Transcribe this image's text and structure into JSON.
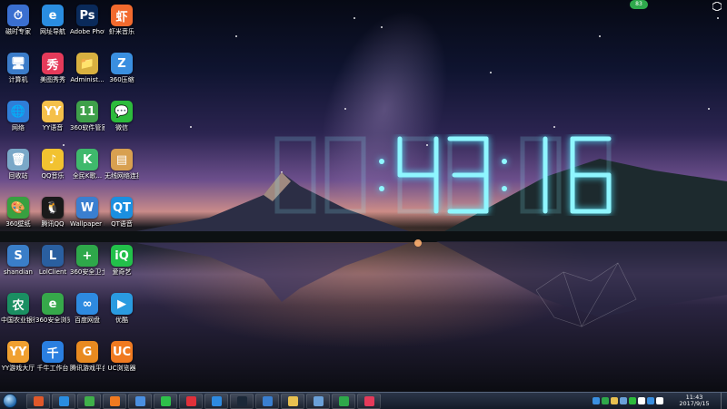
{
  "wallpaper_clock": {
    "digits": "11:43:16"
  },
  "badge": {
    "text": "83"
  },
  "desktop_icons": [
    {
      "name": "icon-0",
      "label": "磁时专家",
      "color": "#3a6fd0",
      "glyph": "⏱"
    },
    {
      "name": "icon-1",
      "label": "网址导航",
      "color": "#2a8de0",
      "glyph": "e"
    },
    {
      "name": "icon-2",
      "label": "Adobe Photosh...",
      "color": "#0a2a5a",
      "glyph": "Ps"
    },
    {
      "name": "icon-3",
      "label": "虾米音乐",
      "color": "#f26a2e",
      "glyph": "虾"
    },
    {
      "name": "icon-4",
      "label": "计算机",
      "color": "#3b7cc9",
      "glyph": "🖥"
    },
    {
      "name": "icon-5",
      "label": "美图秀秀",
      "color": "#e53a5a",
      "glyph": "秀"
    },
    {
      "name": "icon-6",
      "label": "Administ...",
      "color": "#d8b040",
      "glyph": "📁"
    },
    {
      "name": "icon-7",
      "label": "360压缩",
      "color": "#3a8fe0",
      "glyph": "Z"
    },
    {
      "name": "icon-8",
      "label": "网络",
      "color": "#2f7ed8",
      "glyph": "🌐"
    },
    {
      "name": "icon-9",
      "label": "YY语音",
      "color": "#f5c04a",
      "glyph": "YY"
    },
    {
      "name": "icon-10",
      "label": "360软件管家",
      "color": "#3fa04a",
      "glyph": "11"
    },
    {
      "name": "icon-11",
      "label": "微信",
      "color": "#2dbb3c",
      "glyph": "💬"
    },
    {
      "name": "icon-12",
      "label": "回收站",
      "color": "#7aa8c8",
      "glyph": "🗑"
    },
    {
      "name": "icon-13",
      "label": "QQ音乐",
      "color": "#f2c230",
      "glyph": "♪"
    },
    {
      "name": "icon-14",
      "label": "全民K歌...",
      "color": "#3fb96c",
      "glyph": "K"
    },
    {
      "name": "icon-15",
      "label": "无线网络连接...",
      "color": "#d8a050",
      "glyph": "▤"
    },
    {
      "name": "icon-16",
      "label": "360壁纸",
      "color": "#38a040",
      "glyph": "🎨"
    },
    {
      "name": "icon-17",
      "label": "腾讯QQ",
      "color": "#1a1a1a",
      "glyph": "🐧"
    },
    {
      "name": "icon-18",
      "label": "Wallpaper Engine",
      "color": "#3a7fd0",
      "glyph": "W"
    },
    {
      "name": "icon-19",
      "label": "QT语音",
      "color": "#1b8fe0",
      "glyph": "QT"
    },
    {
      "name": "icon-20",
      "label": "shandian",
      "color": "#3a7ec8",
      "glyph": "S"
    },
    {
      "name": "icon-21",
      "label": "LolClient",
      "color": "#2a5fa0",
      "glyph": "L"
    },
    {
      "name": "icon-22",
      "label": "360安全卫士",
      "color": "#2ea84a",
      "glyph": "+"
    },
    {
      "name": "icon-23",
      "label": "爱奇艺",
      "color": "#22c04a",
      "glyph": "iQ"
    },
    {
      "name": "icon-24",
      "label": "中国农业银行网银助手",
      "color": "#1a8f62",
      "glyph": "农"
    },
    {
      "name": "icon-25",
      "label": "360安全浏览器",
      "color": "#36a84a",
      "glyph": "e"
    },
    {
      "name": "icon-26",
      "label": "百度网盘",
      "color": "#2e8ae0",
      "glyph": "∞"
    },
    {
      "name": "icon-27",
      "label": "优酷",
      "color": "#2a9be0",
      "glyph": "▶"
    },
    {
      "name": "icon-28",
      "label": "YY游戏大厅",
      "color": "#f0a030",
      "glyph": "YY"
    },
    {
      "name": "icon-29",
      "label": "千牛工作台",
      "color": "#2a7fe0",
      "glyph": "千"
    },
    {
      "name": "icon-30",
      "label": "腾讯游戏平台",
      "color": "#e88a20",
      "glyph": "G"
    },
    {
      "name": "icon-31",
      "label": "UC浏览器",
      "color": "#f07a20",
      "glyph": "UC"
    }
  ],
  "taskbar": {
    "buttons": [
      {
        "name": "taskbar-color-app",
        "color": "#e0582a"
      },
      {
        "name": "taskbar-ie",
        "color": "#2a8de0"
      },
      {
        "name": "taskbar-360-browser",
        "color": "#3fb04a"
      },
      {
        "name": "taskbar-uc",
        "color": "#f07a20"
      },
      {
        "name": "taskbar-wallpaper-engine",
        "color": "#4a8fe0"
      },
      {
        "name": "taskbar-iqiyi",
        "color": "#2ec04a"
      },
      {
        "name": "taskbar-media",
        "color": "#e0303a"
      },
      {
        "name": "taskbar-baidu-netdisk",
        "color": "#2e8ae0"
      },
      {
        "name": "taskbar-steam",
        "color": "#1b2838"
      },
      {
        "name": "taskbar-wallpaper-engine-2",
        "color": "#3a7fd0"
      },
      {
        "name": "taskbar-explorer",
        "color": "#e8c050"
      },
      {
        "name": "taskbar-notepad",
        "color": "#6aa0d8"
      },
      {
        "name": "taskbar-360-safe",
        "color": "#2ea84a"
      },
      {
        "name": "taskbar-meitu",
        "color": "#e53a5a"
      }
    ],
    "tray_icons": [
      "#3a8fe0",
      "#2ea84a",
      "#e8c050",
      "#6aa0d8",
      "#2dbb3c",
      "#ffffff",
      "#3a8fe0",
      "#ffffff"
    ],
    "time": "11:43",
    "date": "2017/9/15"
  }
}
